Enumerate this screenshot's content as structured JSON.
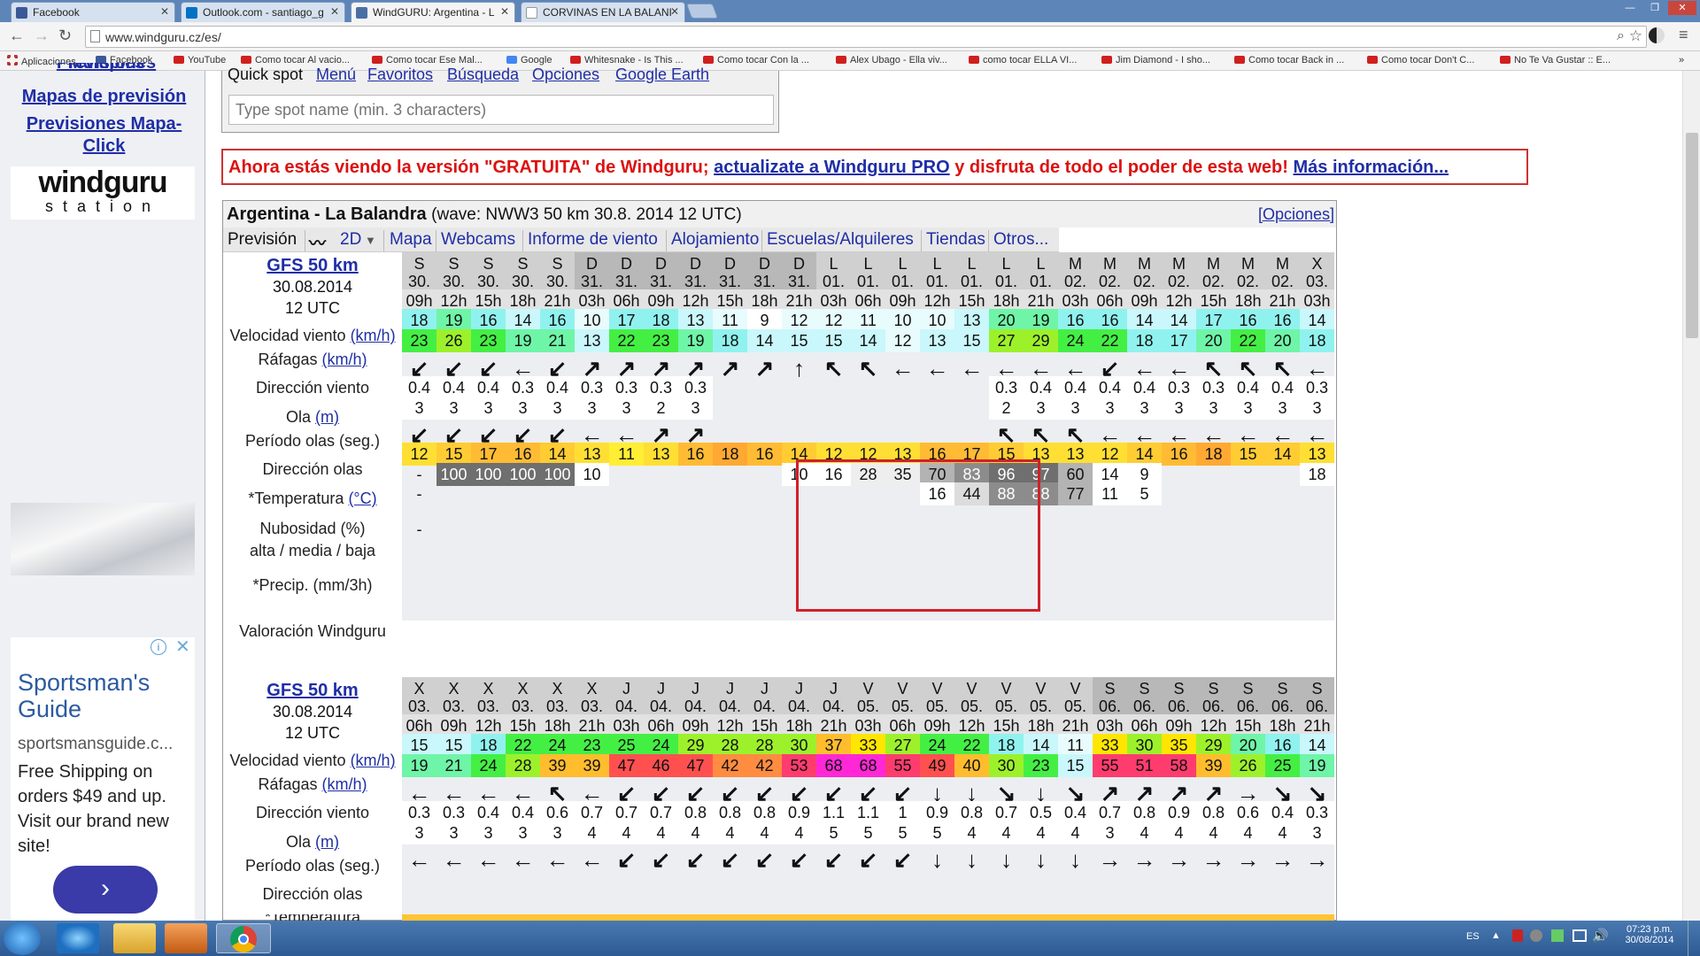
{
  "browser": {
    "tabs": [
      {
        "title": "Facebook",
        "color": "#3b5998"
      },
      {
        "title": "Outlook.com - santiago_g",
        "color": "#0072c6"
      },
      {
        "title": "WindGURU: Argentina - L",
        "color": "#4a6fa5"
      },
      {
        "title": "CORVINAS EN LA BALANI",
        "color": "#ffffff"
      }
    ],
    "url": "www.windguru.cz/es/",
    "bookmarks": [
      "Aplicaciones",
      "Facebook",
      "YouTube",
      "Como tocar Al vacio...",
      "Como tocar Ese Mal...",
      "Google",
      "Whitesnake - Is This ...",
      "Como tocar Con la ...",
      "Alex Ubago - Ella viv...",
      "como tocar ELLA VI...",
      "Jim Diamond - I sho...",
      "Como tocar Back in ...",
      "Como tocar Don't C...",
      "No Te Va Gustar :: E..."
    ]
  },
  "sidebar": {
    "link_top": "Previsiones Múltiples",
    "link1": "Mapas de previsión",
    "link2a": "Previsiones Mapa-",
    "link2b": "Click",
    "logo_main": "windguru",
    "logo_sub": "station"
  },
  "ad": {
    "title": "Sportsman's Guide",
    "url": "sportsmansguide.c...",
    "desc": "Free Shipping on orders $49 and up. Visit our brand new site!",
    "cta": "›",
    "info": "i",
    "close": "✕"
  },
  "quick": {
    "tabs": [
      "Quick spot",
      "Menú",
      "Favoritos",
      "Búsqueda",
      "Opciones",
      "Google Earth"
    ],
    "placeholder": "Type spot name (min. 3 characters)"
  },
  "banner": {
    "part1": "Ahora estás viendo la versión \"GRATUITA\" de Windguru; ",
    "link1": "actualizate a Windguru PRO",
    "part2": " y disfruta de todo el poder de esta web! ",
    "link2": "Más información..."
  },
  "forecast": {
    "title": "Argentina - La Balandra",
    "subtitle": "(wave: NWW3 50 km 30.8. 2014 12 UTC)",
    "options": "[Opciones]",
    "tabs": [
      "Previsión",
      "2D",
      "Mapa",
      "Webcams",
      "Informe de viento",
      "Alojamiento",
      "Escuelas/Alquileres",
      "Tiendas",
      "Otros..."
    ],
    "model": {
      "name": "GFS 50 km",
      "date": "30.08.2014",
      "run": "12 UTC"
    },
    "labels": {
      "speed": "Velocidad viento",
      "gusts": "Ráfagas",
      "unit_kmh": "(km/h)",
      "dir": "Dirección viento",
      "wave": "Ola",
      "unit_m": "(m)",
      "period": "Período olas (seg.)",
      "wdir": "Dirección olas",
      "temp": "*Temperatura",
      "unit_c": "(°C)",
      "cloud1": "Nubosidad (%)",
      "cloud2": "alta / media / baja",
      "precip": "*Precip. (mm/3h)",
      "rating": "Valoración Windguru"
    },
    "block1": {
      "day": [
        "S",
        "S",
        "S",
        "S",
        "S",
        "D",
        "D",
        "D",
        "D",
        "D",
        "D",
        "D",
        "L",
        "L",
        "L",
        "L",
        "L",
        "L",
        "L",
        "M",
        "M",
        "M",
        "M",
        "M",
        "M",
        "M",
        "X"
      ],
      "date": [
        "30.",
        "30.",
        "30.",
        "30.",
        "30.",
        "31.",
        "31.",
        "31.",
        "31.",
        "31.",
        "31.",
        "31.",
        "01.",
        "01.",
        "01.",
        "01.",
        "01.",
        "01.",
        "01.",
        "02.",
        "02.",
        "02.",
        "02.",
        "02.",
        "02.",
        "02.",
        "03."
      ],
      "hour": [
        "09h",
        "12h",
        "15h",
        "18h",
        "21h",
        "03h",
        "06h",
        "09h",
        "12h",
        "15h",
        "18h",
        "21h",
        "03h",
        "06h",
        "09h",
        "12h",
        "15h",
        "18h",
        "21h",
        "03h",
        "06h",
        "09h",
        "12h",
        "15h",
        "18h",
        "21h",
        "03h"
      ],
      "speed": [
        "18",
        "19",
        "16",
        "14",
        "16",
        "10",
        "17",
        "18",
        "13",
        "11",
        "9",
        "12",
        "12",
        "11",
        "10",
        "10",
        "13",
        "20",
        "19",
        "16",
        "16",
        "14",
        "14",
        "17",
        "16",
        "16",
        "14"
      ],
      "gusts": [
        "23",
        "26",
        "23",
        "19",
        "21",
        "13",
        "22",
        "23",
        "19",
        "18",
        "14",
        "15",
        "15",
        "14",
        "12",
        "13",
        "15",
        "27",
        "29",
        "24",
        "22",
        "18",
        "17",
        "20",
        "22",
        "20",
        "18"
      ],
      "dir": [
        "↙",
        "↙",
        "↙",
        "←",
        "↙",
        "↗",
        "↗",
        "↗",
        "↗",
        "↗",
        "↗",
        "↑",
        "↖",
        "↖",
        "←",
        "←",
        "←",
        "←",
        "←",
        "←",
        "↙",
        "←",
        "←",
        "↖",
        "↖",
        "↖",
        "←"
      ],
      "wave": [
        "0.4",
        "0.4",
        "0.4",
        "0.3",
        "0.4",
        "0.3",
        "0.3",
        "0.3",
        "0.3",
        "",
        "",
        "",
        "",
        "",
        "",
        "",
        "",
        "0.3",
        "0.4",
        "0.4",
        "0.4",
        "0.4",
        "0.3",
        "0.3",
        "0.4",
        "0.4",
        "0.3"
      ],
      "period": [
        "3",
        "3",
        "3",
        "3",
        "3",
        "3",
        "3",
        "2",
        "3",
        "",
        "",
        "",
        "",
        "",
        "",
        "",
        "",
        "2",
        "3",
        "3",
        "3",
        "3",
        "3",
        "3",
        "3",
        "3",
        "3"
      ],
      "wdir": [
        "↙",
        "↙",
        "↙",
        "↙",
        "↙",
        "←",
        "←",
        "↗",
        "↗",
        "",
        "",
        "",
        "",
        "",
        "",
        "",
        "",
        "↖",
        "↖",
        "↖",
        "←",
        "←",
        "←",
        "←",
        "←",
        "←",
        "←"
      ],
      "temp": [
        "12",
        "15",
        "17",
        "16",
        "14",
        "13",
        "11",
        "13",
        "16",
        "18",
        "16",
        "14",
        "12",
        "12",
        "13",
        "16",
        "17",
        "15",
        "13",
        "13",
        "12",
        "14",
        "16",
        "18",
        "15",
        "14",
        "13"
      ],
      "cloud_hi": [
        "-",
        "100",
        "100",
        "100",
        "100",
        "10",
        "",
        "",
        "",
        "",
        "",
        "10",
        "16",
        "28",
        "35",
        "70",
        "83",
        "96",
        "97",
        "60",
        "14",
        "9",
        "",
        "",
        "",
        "",
        "18"
      ],
      "cloud_mid": [
        "-",
        "",
        "",
        "",
        "",
        "",
        "",
        "",
        "",
        "",
        "",
        "",
        "",
        "",
        "",
        "16",
        "44",
        "88",
        "88",
        "77",
        "11",
        "5",
        "",
        "",
        "",
        "",
        ""
      ],
      "precip": [
        "-"
      ]
    },
    "block2": {
      "day": [
        "X",
        "X",
        "X",
        "X",
        "X",
        "X",
        "J",
        "J",
        "J",
        "J",
        "J",
        "J",
        "J",
        "V",
        "V",
        "V",
        "V",
        "V",
        "V",
        "V",
        "S",
        "S",
        "S",
        "S",
        "S",
        "S",
        "S"
      ],
      "date": [
        "03.",
        "03.",
        "03.",
        "03.",
        "03.",
        "03.",
        "04.",
        "04.",
        "04.",
        "04.",
        "04.",
        "04.",
        "04.",
        "05.",
        "05.",
        "05.",
        "05.",
        "05.",
        "05.",
        "05.",
        "06.",
        "06.",
        "06.",
        "06.",
        "06.",
        "06.",
        "06."
      ],
      "hour": [
        "06h",
        "09h",
        "12h",
        "15h",
        "18h",
        "21h",
        "03h",
        "06h",
        "09h",
        "12h",
        "15h",
        "18h",
        "21h",
        "03h",
        "06h",
        "09h",
        "12h",
        "15h",
        "18h",
        "21h",
        "03h",
        "06h",
        "09h",
        "12h",
        "15h",
        "18h",
        "21h"
      ],
      "speed": [
        "15",
        "15",
        "18",
        "22",
        "24",
        "23",
        "25",
        "24",
        "29",
        "28",
        "28",
        "30",
        "37",
        "33",
        "27",
        "24",
        "22",
        "18",
        "14",
        "11",
        "33",
        "30",
        "35",
        "29",
        "20",
        "16",
        "14"
      ],
      "gusts": [
        "19",
        "21",
        "24",
        "28",
        "39",
        "39",
        "47",
        "46",
        "47",
        "42",
        "42",
        "53",
        "68",
        "68",
        "55",
        "49",
        "40",
        "30",
        "23",
        "15",
        "55",
        "51",
        "58",
        "39",
        "26",
        "25",
        "19"
      ],
      "dir": [
        "←",
        "←",
        "←",
        "←",
        "↖",
        "←",
        "↙",
        "↙",
        "↙",
        "↙",
        "↙",
        "↙",
        "↙",
        "↙",
        "↙",
        "↓",
        "↓",
        "↘",
        "↓",
        "↘",
        "↗",
        "↗",
        "↗",
        "↗",
        "→",
        "↘",
        "↘"
      ],
      "wave": [
        "0.3",
        "0.3",
        "0.4",
        "0.4",
        "0.6",
        "0.7",
        "0.7",
        "0.7",
        "0.8",
        "0.8",
        "0.8",
        "0.9",
        "1.1",
        "1.1",
        "1",
        "0.9",
        "0.8",
        "0.7",
        "0.5",
        "0.4",
        "0.7",
        "0.8",
        "0.9",
        "0.8",
        "0.6",
        "0.4",
        "0.3"
      ],
      "period": [
        "3",
        "3",
        "3",
        "3",
        "3",
        "4",
        "4",
        "4",
        "4",
        "4",
        "4",
        "4",
        "5",
        "5",
        "5",
        "5",
        "4",
        "4",
        "4",
        "4",
        "3",
        "4",
        "4",
        "4",
        "4",
        "4",
        "3"
      ],
      "wdir": [
        "←",
        "←",
        "←",
        "←",
        "←",
        "←",
        "↙",
        "↙",
        "↙",
        "↙",
        "↙",
        "↙",
        "↙",
        "↙",
        "↙",
        "↓",
        "↓",
        "↓",
        "↓",
        "↓",
        "→",
        "→",
        "→",
        "→",
        "→",
        "→",
        "→"
      ]
    }
  },
  "taskbar": {
    "lang": "ES",
    "time": "07:23 p.m.",
    "date": "30/08/2014"
  }
}
